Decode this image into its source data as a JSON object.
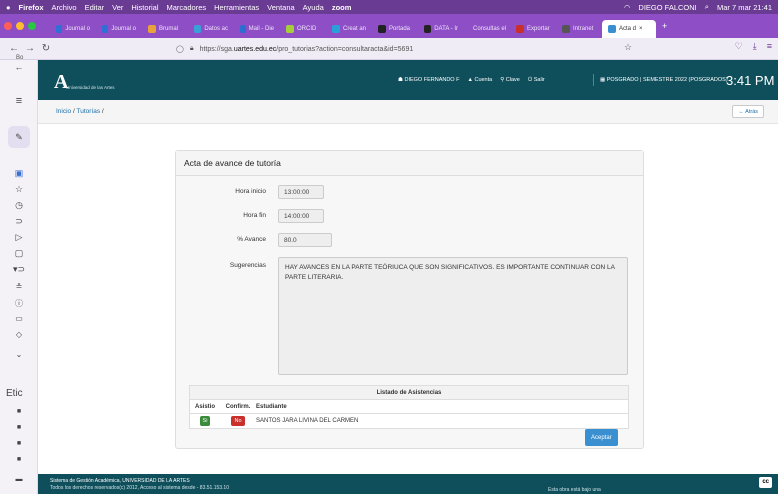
{
  "os_menubar": {
    "app": "Firefox",
    "menus": [
      "Archivo",
      "Editar",
      "Ver",
      "Historial",
      "Marcadores",
      "Herramientas",
      "Ventana",
      "Ayuda"
    ],
    "zoom": "zoom",
    "user": "DIEGO FALCONI",
    "datetime": "Mar 7 mar 21:41"
  },
  "tabs": [
    {
      "label": "Journal o",
      "color": "#2f6fd6"
    },
    {
      "label": "Journal o",
      "color": "#2f6fd6"
    },
    {
      "label": "Brumal",
      "color": "#e8a23a"
    },
    {
      "label": "Datos ac",
      "color": "#3aa0d8"
    },
    {
      "label": "Mail - Die",
      "color": "#2a6fd0"
    },
    {
      "label": "ORCID",
      "color": "#a6ce39"
    },
    {
      "label": "Creat an",
      "color": "#2aa0d8"
    },
    {
      "label": "Portada",
      "color": "#222"
    },
    {
      "label": "DATA - Ir",
      "color": "#222"
    },
    {
      "label": "Consultas el",
      "color": "#888"
    },
    {
      "label": "Exportar",
      "color": "#c9302c"
    },
    {
      "label": "Intranet",
      "color": "#555"
    },
    {
      "label": "Acta d",
      "color": "#3a8fd1",
      "active": true
    }
  ],
  "url": {
    "prefix": "https://sga.",
    "domain": "uartes.edu.ec",
    "rest": "/pro_tutorias?action=consultaracta&id=5691"
  },
  "sidebar": {
    "bookmarks_label": "Bo",
    "section_label": "Etic"
  },
  "header": {
    "logo_letter": "A",
    "logo_subtitle": "Universidad de las Artes",
    "user": "DIEGO FERNANDO F",
    "account": "Cuenta",
    "key": "Clave",
    "logout": "Salir",
    "period": "POSGRADO | SEMESTRE 2022 (POSGRADOS)",
    "time": "3:41 PM"
  },
  "breadcrumb": {
    "home": "Inicio",
    "sep": " / ",
    "current": "Tutorías",
    "tail": " /"
  },
  "back_button": "← Atrás",
  "panel": {
    "title": "Acta de avance de tutoría",
    "fields": {
      "hora_inicio": {
        "label": "Hora inicio",
        "value": "13:00:00"
      },
      "hora_fin": {
        "label": "Hora fin",
        "value": "14:00:00"
      },
      "avance": {
        "label": "% Avance",
        "value": "80.0"
      },
      "sugerencias": {
        "label": "Sugerencias",
        "value": "HAY AVANCES EN LA PARTE TEÓRIUCA QUE SON SIGNIFICATIVOS. ES IMPORTANTE CONTINUAR CON LA PARTE LITERARIA."
      }
    },
    "attendance": {
      "title": "Listado de Asistencias",
      "headers": [
        "Asistio",
        "Confirm.",
        "Estudiante"
      ],
      "rows": [
        {
          "asistio": "Si",
          "confirm": "No",
          "student": "SANTOS JARA LIVINA DEL CARMEN"
        }
      ]
    },
    "accept": "Aceptar"
  },
  "footer": {
    "line1": "Sistema de Gestión Académica, UNIVERSIDAD DE LA ARTES",
    "line2": "Todos los derechos reservados(c) 2012, Acceso al sistema desde - 83.51.153.10",
    "right": "Esta obra está bajo una",
    "cc": "cc"
  },
  "colors": {
    "accent": "#0f4f5c",
    "firefox": "#6a3b93",
    "button": "#3a8fd1",
    "success": "#3c8b3c",
    "danger": "#c9302c"
  }
}
